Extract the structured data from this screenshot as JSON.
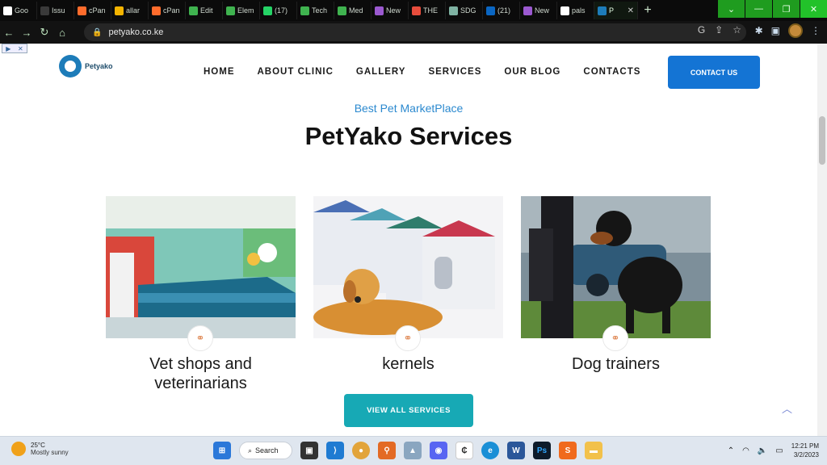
{
  "browser": {
    "tabs": [
      {
        "label": "Goo",
        "color": "#ffffff"
      },
      {
        "label": "Issu",
        "color": "#3a3a3a"
      },
      {
        "label": "cPan",
        "color": "#ff6c2c"
      },
      {
        "label": "allar",
        "color": "#f4b400"
      },
      {
        "label": "cPan",
        "color": "#ff6c2c"
      },
      {
        "label": "Edit",
        "color": "#3fb34f"
      },
      {
        "label": "Elem",
        "color": "#3fb34f"
      },
      {
        "label": "(17)",
        "color": "#25d366"
      },
      {
        "label": "Tech",
        "color": "#3fb34f"
      },
      {
        "label": "Med",
        "color": "#3fb34f"
      },
      {
        "label": "New",
        "color": "#9b59d0"
      },
      {
        "label": "THE",
        "color": "#e74c3c"
      },
      {
        "label": "SDG",
        "color": "#7fb3a3"
      },
      {
        "label": "(21)",
        "color": "#0a66c2"
      },
      {
        "label": "New",
        "color": "#9b59d0"
      },
      {
        "label": "pals",
        "color": "#ffffff"
      },
      {
        "label": "P",
        "color": "#1d7cb9",
        "active": true
      }
    ],
    "url": "petyako.co.ke"
  },
  "site": {
    "brand": "Petyako",
    "nav": [
      "HOME",
      "ABOUT CLINIC",
      "GALLERY",
      "SERVICES",
      "OUR BLOG",
      "CONTACTS"
    ],
    "cta": "CONTACT US",
    "eyebrow": "Best Pet MarketPlace",
    "heading": "PetYako Services",
    "services": [
      {
        "title_line1": "Vet shops and",
        "title_line2": "veterinarians"
      },
      {
        "title_line1": "kernels",
        "title_line2": ""
      },
      {
        "title_line1": "Dog trainers",
        "title_line2": ""
      }
    ],
    "view_all": "VIEW ALL SERVICES"
  },
  "taskbar": {
    "temperature": "25°C",
    "weather": "Mostly sunny",
    "search": "Search",
    "time": "12:21 PM",
    "date": "3/2/2023"
  },
  "colors": {
    "accent_blue": "#1474d4",
    "teal": "#17a9b5",
    "eyebrow": "#2b89cf"
  }
}
